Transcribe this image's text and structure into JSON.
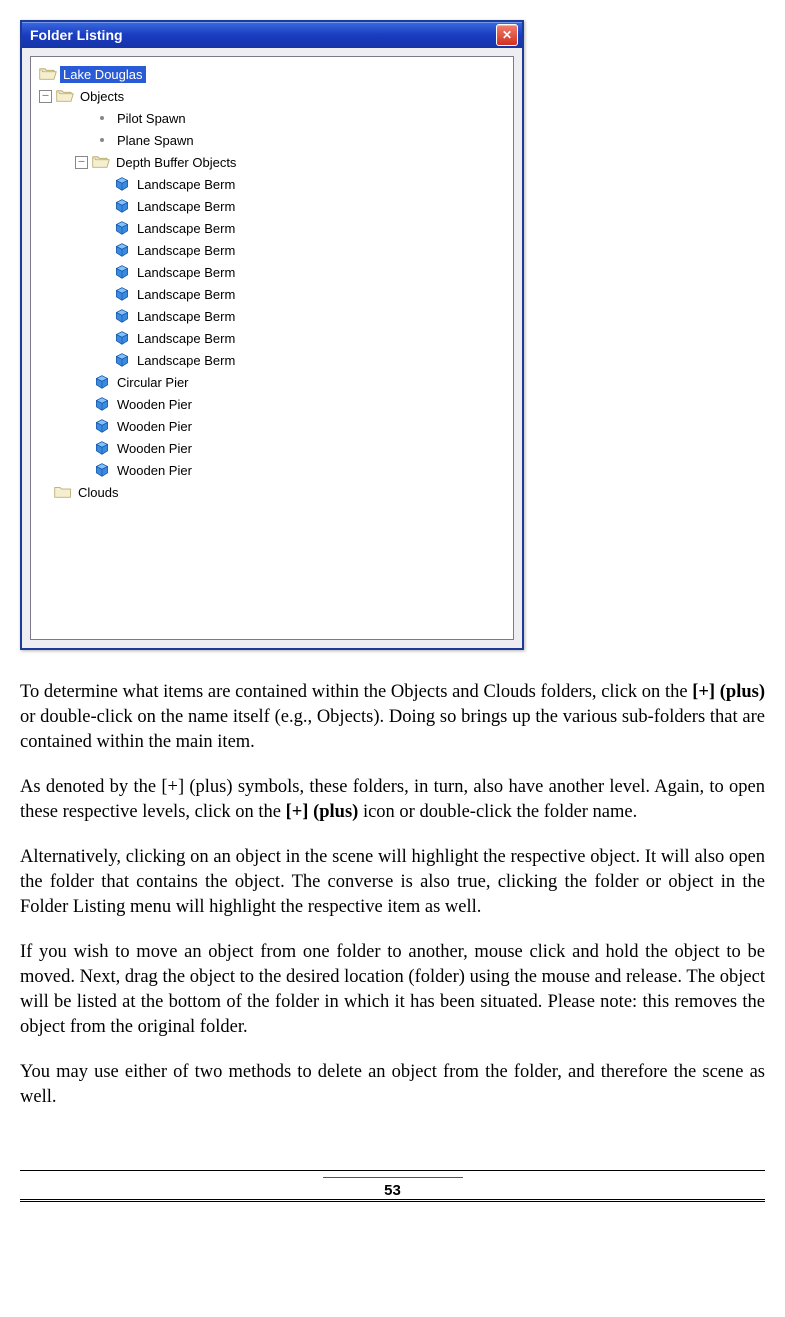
{
  "window": {
    "title": "Folder Listing"
  },
  "tree": {
    "root": "Lake Douglas",
    "objects": "Objects",
    "pilot": "Pilot Spawn",
    "plane": "Plane Spawn",
    "depth": "Depth Buffer Objects",
    "berm": "Landscape Berm",
    "circular": "Circular Pier",
    "wooden": "Wooden Pier",
    "clouds": "Clouds"
  },
  "paragraphs": {
    "p1a": "To determine what items are contained within the Objects and Clouds folders, click on the ",
    "p1b": "[+] (plus)",
    "p1c": " or double-click on the name itself (e.g., Objects).  Doing so brings up the various sub-folders that are contained within the main item.",
    "p2a": "As denoted by the [+] (plus) symbols, these folders, in turn, also have another level.  Again, to open these respective levels, click on the ",
    "p2b": "[+] (plus)",
    "p2c": " icon or double-click the folder name.",
    "p3": "Alternatively, clicking on an object in the scene will highlight the respective object.  It will also open the folder that contains the object.  The converse is also true, clicking the folder or object in the Folder Listing menu will highlight the respective item as well.",
    "p4": "If you wish to move an object from one folder to another, mouse click and hold the object to be moved.  Next, drag the object to the desired location (folder) using the mouse and release.  The object will be listed at the bottom of the folder in which it has been situated.  Please note:  this removes the object from the original folder.",
    "p5": "You may use either of two methods to delete an object from the folder, and therefore the scene as well."
  },
  "page_number": "53"
}
